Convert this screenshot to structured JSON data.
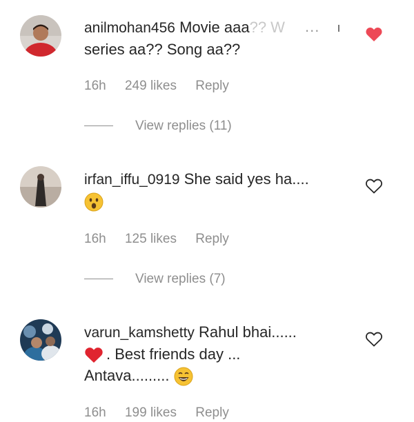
{
  "comments": [
    {
      "username": "anilmohan456",
      "text_line1": "Movie aaa",
      "text_faded": "?? W",
      "text_line2": "series aa?? Song aa??",
      "time": "16h",
      "likes": "249 likes",
      "reply": "Reply",
      "view_replies": "View replies (11)",
      "liked": true
    },
    {
      "username": "irfan_iffu_0919",
      "text_line1": "She said yes ha....",
      "time": "16h",
      "likes": "125 likes",
      "reply": "Reply",
      "view_replies": "View replies (7)",
      "liked": false
    },
    {
      "username": "varun_kamshetty",
      "text_line1": "Rahul bhai......",
      "text_line2": ". Best friends day ...",
      "text_line3": "Antava.........",
      "time": "16h",
      "likes": "199 likes",
      "reply": "Reply",
      "liked": false
    }
  ],
  "overlay": {
    "more_dots": "...",
    "cursor_mark": "ı"
  },
  "colors": {
    "liked_heart": "#ed4956",
    "meta_text": "#8e8e8e",
    "primary_text": "#262626"
  },
  "icons": [
    "heart-filled-icon",
    "heart-outline-icon",
    "surprised-emoji-icon",
    "red-heart-emoji-icon",
    "laughing-emoji-icon"
  ]
}
